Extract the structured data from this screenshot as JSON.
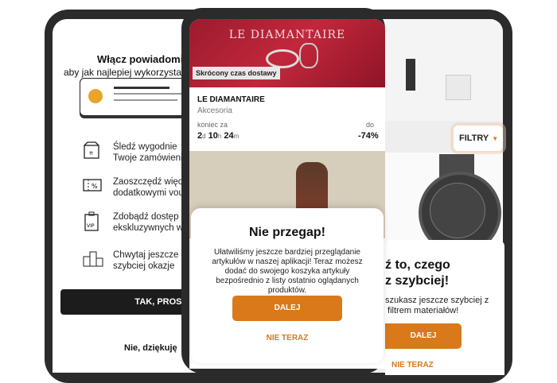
{
  "left_screen": {
    "title": "Włącz powiadomienia",
    "subtitle": "aby jak najlepiej wykorzystać Z",
    "features": [
      {
        "icon": "box-icon",
        "text": "Śledź wygodnie\nTwoje zamówienie"
      },
      {
        "icon": "coupon-icon",
        "text": "Zaoszczędź więcej\ndodatkowymi vouch"
      },
      {
        "icon": "vip-icon",
        "text": "Zdobądź dostęp do\nekskluzywnych wyp"
      },
      {
        "icon": "podium-icon",
        "text": "Chwytaj jeszcze\nszybciej okazje"
      }
    ],
    "primary_button": "TAK, PROSZĘ",
    "secondary_button": "Nie, dziękuję"
  },
  "phone": {
    "banner_logo": "LE DIAMANTAIRE",
    "badge": "Skrócony czas dostawy",
    "brand": "LE DIAMANTAIRE",
    "category": "Akcesoria",
    "ends_label": "koniec za",
    "timer": {
      "d": "2",
      "d_unit": "d",
      "h": "10",
      "h_unit": "h",
      "m": "24",
      "m_unit": "m"
    },
    "discount_label": "do",
    "discount": "-74%",
    "modal": {
      "title": "Nie przegap!",
      "text": "Ułatwiliśmy jeszcze bardziej przeglądanie artykułów w naszej aplikacji! Teraz możesz dodać do swojego koszyka artykuły bezpośrednio z listy ostatnio oglądanych produktów.",
      "primary": "DALEJ",
      "secondary": "NIE TERAZ"
    }
  },
  "right_screen": {
    "filter_button": "FILTRY",
    "modal_title": "ź to, czego\nz szybciej!",
    "modal_text": "szukasz jeszcze szybciej z\n filtrem materiałów!",
    "primary": "DALEJ",
    "secondary": "NIE TERAZ"
  },
  "colors": {
    "accent": "#d9791a",
    "dark": "#1c1c1c",
    "logo": "#e8a52a"
  }
}
